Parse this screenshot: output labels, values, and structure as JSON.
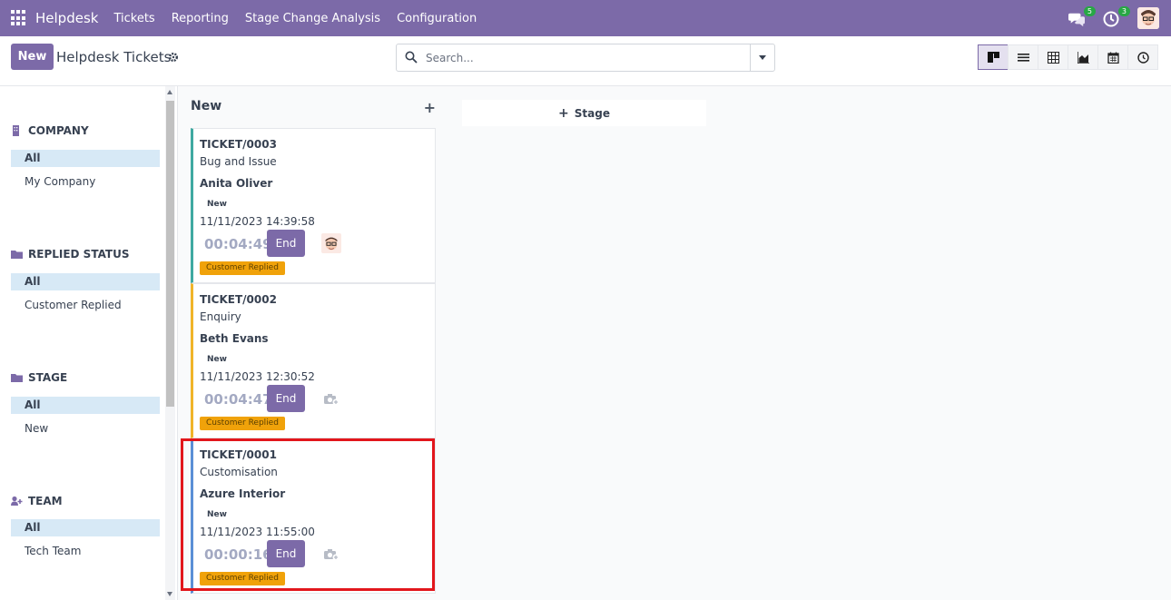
{
  "navbar": {
    "brand": "Helpdesk",
    "menu": [
      "Tickets",
      "Reporting",
      "Stage Change Analysis",
      "Configuration"
    ],
    "messages_count": "5",
    "activities_count": "3"
  },
  "control": {
    "new_label": "New",
    "title": "Helpdesk Tickets",
    "search_placeholder": "Search...",
    "views": [
      "kanban",
      "list",
      "pivot",
      "graph",
      "calendar",
      "activity"
    ],
    "active_view": "kanban"
  },
  "sidebar": {
    "sections": [
      {
        "title": "COMPANY",
        "icon": "building-icon",
        "items": [
          "All",
          "My Company"
        ],
        "active": 0
      },
      {
        "title": "REPLIED STATUS",
        "icon": "folder-icon",
        "items": [
          "All",
          "Customer Replied"
        ],
        "active": 0
      },
      {
        "title": "STAGE",
        "icon": "folder-icon",
        "items": [
          "All",
          "New"
        ],
        "active": 0
      },
      {
        "title": "TEAM",
        "icon": "users-icon",
        "items": [
          "All",
          "Tech Team"
        ],
        "active": 0
      }
    ]
  },
  "kanban": {
    "column_title": "New",
    "add_stage_label": "Stage",
    "cards": [
      {
        "number": "TICKET/0003",
        "type": "Bug and Issue",
        "customer": "Anita Oliver",
        "stage": "New",
        "datetime": "11/11/2023 14:39:58",
        "timer": "00:04:49",
        "end_label": "End",
        "tag": "Customer Replied",
        "color": "#3fa9a1",
        "has_avatar": true
      },
      {
        "number": "TICKET/0002",
        "type": "Enquiry",
        "customer": "Beth Evans",
        "stage": "New",
        "datetime": "11/11/2023 12:30:52",
        "timer": "00:04:47",
        "end_label": "End",
        "tag": "Customer Replied",
        "color": "#f0b429",
        "has_avatar": false
      },
      {
        "number": "TICKET/0001",
        "type": "Customisation",
        "customer": "Azure Interior",
        "stage": "New",
        "datetime": "11/11/2023 11:55:00",
        "timer": "00:00:16",
        "end_label": "End",
        "tag": "Customer Replied",
        "color": "#5b8fd6",
        "has_avatar": false
      }
    ]
  },
  "colors": {
    "brand": "#7c6aa8",
    "highlight": "#e2161c",
    "tag": "#f0a20a"
  }
}
